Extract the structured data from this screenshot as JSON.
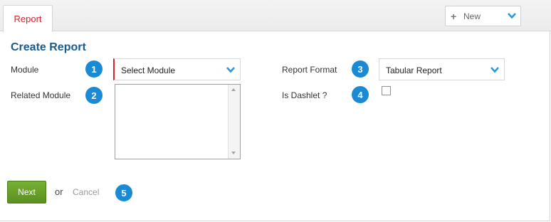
{
  "tabs": {
    "report_label": "Report"
  },
  "actions": {
    "new_label": "New"
  },
  "form": {
    "title": "Create Report",
    "module_label": "Module",
    "module_select_value": "Select Module",
    "related_module_label": "Related Module",
    "report_format_label": "Report Format",
    "report_format_value": "Tabular Report",
    "is_dashlet_label": "Is Dashlet ?",
    "is_dashlet_checked": false
  },
  "badges": [
    "1",
    "2",
    "3",
    "4",
    "5"
  ],
  "buttons": {
    "next_label": "Next",
    "or_text": "or",
    "cancel_label": "Cancel"
  },
  "colors": {
    "accent_blue": "#1a8ad4",
    "title_blue": "#1b5a8c",
    "tab_red": "#d9222f",
    "next_green": "#6aa22a"
  },
  "icons": {
    "new": "plus-icon",
    "dropdown": "chevron-down-icon"
  }
}
